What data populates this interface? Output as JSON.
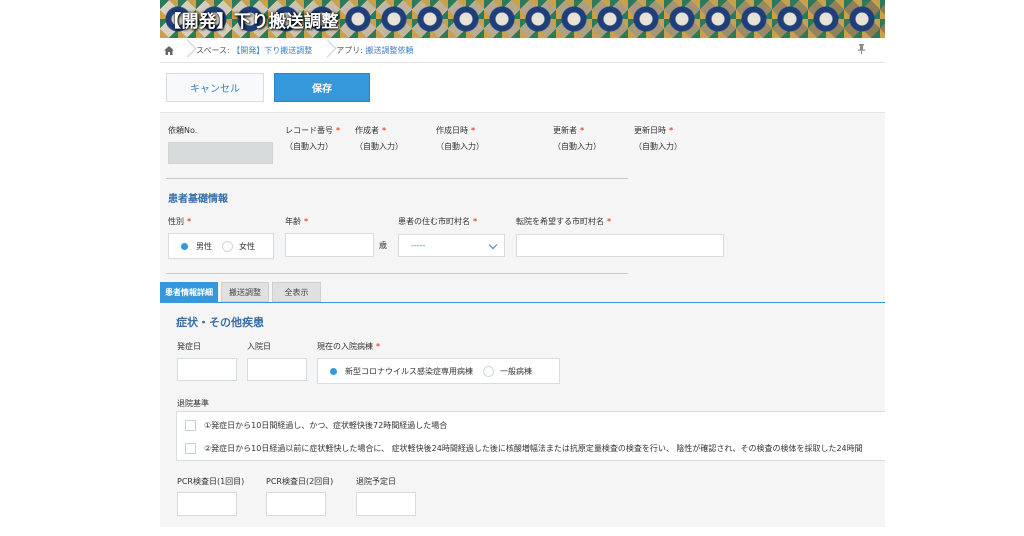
{
  "header": {
    "title": "【開発】下り搬送調整"
  },
  "breadcrumb": {
    "space_prefix": "スペース:",
    "space_name": "【開発】下り搬送調整",
    "app_prefix": "アプリ:",
    "app_name": "搬送調整依頼"
  },
  "toolbar": {
    "cancel_label": "キャンセル",
    "save_label": "保存"
  },
  "record_header": {
    "request_no": {
      "label": "依頼No."
    },
    "record_number": {
      "label": "レコード番号",
      "value": "（自動入力）"
    },
    "creator": {
      "label": "作成者",
      "value": "（自動入力）"
    },
    "created_at": {
      "label": "作成日時",
      "value": "（自動入力）"
    },
    "updater": {
      "label": "更新者",
      "value": "（自動入力）"
    },
    "updated_at": {
      "label": "更新日時",
      "value": "（自動入力）"
    },
    "required_mark": "*"
  },
  "patient_basic": {
    "title": "患者基礎情報",
    "sex": {
      "label": "性別",
      "options": [
        "男性",
        "女性"
      ],
      "selected": "男性"
    },
    "age": {
      "label": "年齢",
      "unit": "歳",
      "value": ""
    },
    "city": {
      "label": "患者の住む市町村名",
      "selected": "-----"
    },
    "transfer_city": {
      "label": "転院を希望する市町村名",
      "value": ""
    }
  },
  "tabs": [
    {
      "label": "患者情報詳細",
      "active": true
    },
    {
      "label": "搬送調整",
      "active": false
    },
    {
      "label": "全表示",
      "active": false
    }
  ],
  "symptoms": {
    "title": "症状・その他疾患",
    "onset_date": {
      "label": "発症日"
    },
    "admission_date": {
      "label": "入院日"
    },
    "ward": {
      "label": "現在の入院病棟",
      "options": [
        "新型コロナウイルス感染症専用病棟",
        "一般病棟"
      ],
      "selected": "新型コロナウイルス感染症専用病棟"
    },
    "discharge_criteria": {
      "label": "退院基準",
      "options": [
        "①発症日から10日間経過し、かつ、症状軽快後72時間経過した場合",
        "②発症日から10日経過以前に症状軽快した場合に、 症状軽快後24時間経過した後に核酸増幅法または抗原定量検査の検査を行い、 陰性が確認され、その検査の検体を採取した24時間"
      ]
    },
    "pcr1": {
      "label": "PCR検査日(1回目)"
    },
    "pcr2": {
      "label": "PCR検査日(2回目)"
    },
    "discharge_plan": {
      "label": "退院予定日"
    }
  },
  "colors": {
    "accent": "#3498db",
    "link": "#3b7fc4",
    "required": "#e74c3c",
    "section_title": "#3b6fa8"
  }
}
